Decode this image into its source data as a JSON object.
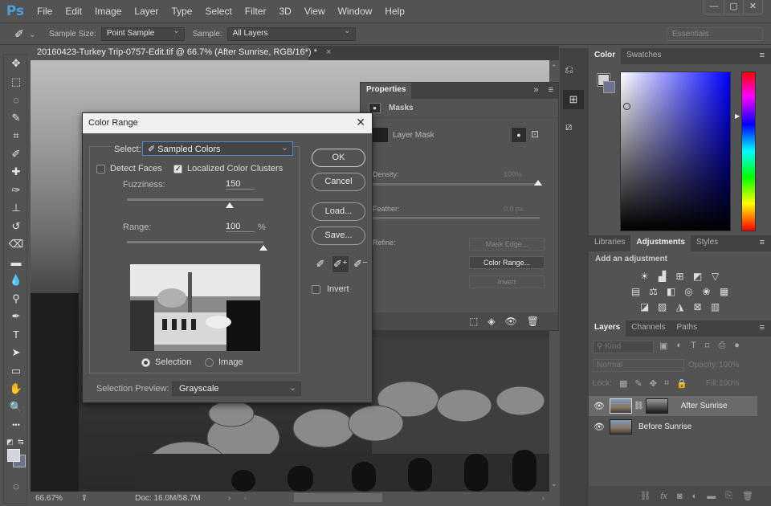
{
  "app": {
    "logo": "Ps"
  },
  "menu": [
    "File",
    "Edit",
    "Image",
    "Layer",
    "Type",
    "Select",
    "Filter",
    "3D",
    "View",
    "Window",
    "Help"
  ],
  "window_controls": {
    "minimize": "—",
    "maximize": "▢",
    "close": "✕"
  },
  "options_bar": {
    "tool_icon": "eyedropper-icon",
    "sample_size_label": "Sample Size:",
    "sample_size_value": "Point Sample",
    "sample_label": "Sample:",
    "sample_value": "All Layers",
    "workspace": "Essentials"
  },
  "document": {
    "tab_title": "20160423-Turkey Trip-0757-Edit.tif @ 66.7% (After Sunrise, RGB/16*) *",
    "tab_close": "×",
    "zoom": "66.67%",
    "doc_info": "Doc: 16.0M/58.7M"
  },
  "tools": [
    {
      "name": "move-tool",
      "glyph": "✥"
    },
    {
      "name": "marquee-tool",
      "glyph": "⬚"
    },
    {
      "name": "lasso-tool",
      "glyph": "◌"
    },
    {
      "name": "quick-selection-tool",
      "glyph": "✎"
    },
    {
      "name": "crop-tool",
      "glyph": "⌗"
    },
    {
      "name": "eyedropper-tool",
      "glyph": "✐"
    },
    {
      "name": "healing-brush-tool",
      "glyph": "✚"
    },
    {
      "name": "brush-tool",
      "glyph": "✑"
    },
    {
      "name": "clone-stamp-tool",
      "glyph": "⊥"
    },
    {
      "name": "history-brush-tool",
      "glyph": "↺"
    },
    {
      "name": "eraser-tool",
      "glyph": "⌫"
    },
    {
      "name": "gradient-tool",
      "glyph": "▬"
    },
    {
      "name": "blur-tool",
      "glyph": "💧"
    },
    {
      "name": "dodge-tool",
      "glyph": "⚲"
    },
    {
      "name": "pen-tool",
      "glyph": "✒"
    },
    {
      "name": "type-tool",
      "glyph": "T"
    },
    {
      "name": "path-selection-tool",
      "glyph": "➤"
    },
    {
      "name": "rectangle-tool",
      "glyph": "▭"
    },
    {
      "name": "hand-tool",
      "glyph": "✋"
    },
    {
      "name": "zoom-tool",
      "glyph": "🔍"
    },
    {
      "name": "more-tools",
      "glyph": "•••"
    }
  ],
  "colors": {
    "foreground": "#d4d3dc",
    "background": "#6e7390",
    "accent": "#4e9fd9"
  },
  "properties": {
    "tab": "Properties",
    "section": "Masks",
    "layer_mask": "Layer Mask",
    "density_label": "Density:",
    "density_value": "100%",
    "feather_label": "Feather:",
    "feather_value": "0.0 px",
    "refine_label": "Refine:",
    "mask_edge_btn": "Mask Edge...",
    "color_range_btn": "Color Range...",
    "invert_btn": "Invert"
  },
  "color_range": {
    "title": "Color Range",
    "select_label": "Select:",
    "select_value": "Sampled Colors",
    "detect_faces": "Detect Faces",
    "detect_faces_checked": false,
    "localized": "Localized Color Clusters",
    "localized_checked": true,
    "fuzziness_label": "Fuzziness:",
    "fuzziness_value": "150",
    "fuzziness_fraction": 0.75,
    "range_label": "Range:",
    "range_value": "100",
    "range_unit": "%",
    "range_fraction": 1.0,
    "radio_selection": "Selection",
    "radio_image": "Image",
    "radio_selected": "Selection",
    "preview_label": "Selection Preview:",
    "preview_value": "Grayscale",
    "ok": "OK",
    "cancel": "Cancel",
    "load": "Load...",
    "save": "Save...",
    "invert": "Invert",
    "invert_checked": false
  },
  "color_panel": {
    "tabs": [
      "Color",
      "Swatches"
    ],
    "active": "Color"
  },
  "adjustments_panel": {
    "tabs": [
      "Libraries",
      "Adjustments",
      "Styles"
    ],
    "active": "Adjustments",
    "heading": "Add an adjustment",
    "rows": [
      [
        "brightness-contrast",
        "levels",
        "curves",
        "exposure",
        "vibrance"
      ],
      [
        "hue-saturation",
        "color-balance",
        "black-white",
        "photo-filter",
        "channel-mixer",
        "color-lookup"
      ],
      [
        "invert",
        "posterize",
        "threshold",
        "selective-color",
        "gradient-map"
      ]
    ]
  },
  "layers_panel": {
    "tabs": [
      "Layers",
      "Channels",
      "Paths"
    ],
    "active": "Layers",
    "filter_kind": "Kind",
    "blend_mode": "Normal",
    "opacity_label": "Opacity:",
    "opacity_value": "100%",
    "lock_label": "Lock:",
    "fill_label": "Fill:",
    "fill_value": "100%",
    "layers": [
      {
        "name": "After Sunrise",
        "visible": true,
        "selected": true,
        "has_mask": true
      },
      {
        "name": "Before Sunrise",
        "visible": true,
        "selected": false,
        "has_mask": false
      }
    ]
  }
}
